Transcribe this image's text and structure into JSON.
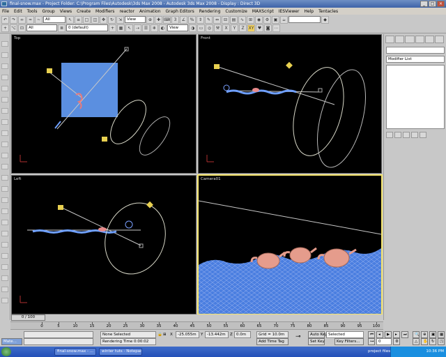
{
  "title": "final-snow.max  -  Project Folder: C:\\Program Files\\Autodesk\\3ds Max 2008   -  Autodesk 3ds Max 2008   -  Display : Direct 3D",
  "menu": [
    "File",
    "Edit",
    "Tools",
    "Group",
    "Views",
    "Create",
    "Modifiers",
    "reactor",
    "Animation",
    "Graph Editors",
    "Rendering",
    "Customize",
    "MAXScript",
    "IESViewer",
    "Help",
    "Tentacles"
  ],
  "toolbar": {
    "selection_filter": "All",
    "layer": "0 (default)",
    "view": "View",
    "view2": "View",
    "axis_x": "X",
    "axis_y": "Y",
    "axis_z": "Z",
    "axis_xy": "XY"
  },
  "viewports": {
    "top": "Top",
    "front": "Front",
    "left": "Left",
    "camera": "Camera01"
  },
  "command_panel": {
    "modifier_list": "Modifier List"
  },
  "time_slider": {
    "frame": "0 / 100"
  },
  "track_ticks": [
    0,
    5,
    10,
    15,
    20,
    25,
    30,
    35,
    40,
    45,
    50,
    55,
    60,
    65,
    70,
    75,
    80,
    85,
    90,
    95,
    100
  ],
  "status": {
    "maxscript": "Mate...",
    "selection": "None Selected",
    "render_time": "Rendering Time  0:00:02",
    "x_label": "X",
    "x_value": "-25.055m",
    "y_label": "Y",
    "y_value": "-13.442m",
    "z_label": "Z",
    "z_value": "0.0m",
    "grid": "Grid = 10.0m",
    "add_time_tag": "Add Time Tag",
    "auto_key": "Auto Key",
    "auto_key_sel": "Selected",
    "set_key": "Set Key",
    "key_filters": "Key Filters...",
    "frame_field": "0"
  },
  "taskbar": {
    "tasks": [
      "final-snow.max - ...",
      "winter tuts - Notepad"
    ],
    "tray_label": "project files",
    "clock": "10:36 PM"
  }
}
